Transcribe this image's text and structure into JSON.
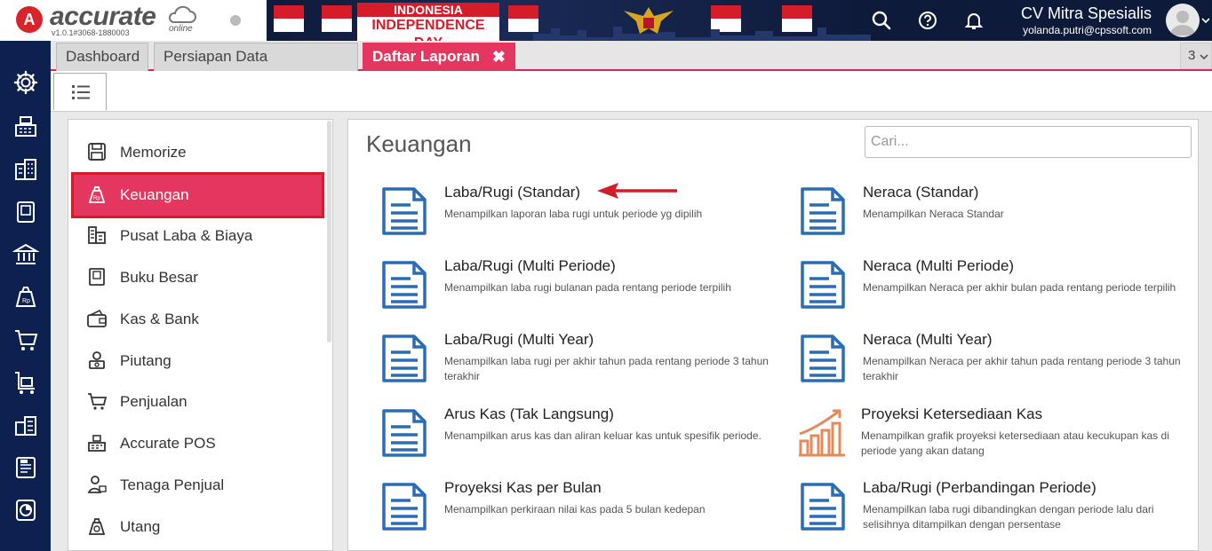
{
  "app": {
    "logo_letter": "A",
    "logo_text": "accurate",
    "logo_sub": "online",
    "version": "v1.0.1#3068-1880003"
  },
  "banner": {
    "line1": "INDONESIA",
    "line2": "INDEPENDENCE DAY"
  },
  "user": {
    "company": "CV Mitra Spesialis",
    "email": "yolanda.putri@cpssoft.com"
  },
  "tabs": [
    {
      "label": "Dashboard"
    },
    {
      "label": "Persiapan Data Perusahaan"
    },
    {
      "label": "Daftar Laporan"
    }
  ],
  "tab_close": "✖",
  "tab_count": "3",
  "sidebar": {
    "items": [
      {
        "label": "Memorize",
        "icon": "save-icon"
      },
      {
        "label": "Keuangan",
        "icon": "money-bag-icon"
      },
      {
        "label": "Pusat Laba & Biaya",
        "icon": "building-icon"
      },
      {
        "label": "Buku Besar",
        "icon": "ledger-icon"
      },
      {
        "label": "Kas & Bank",
        "icon": "wallet-icon"
      },
      {
        "label": "Piutang",
        "icon": "receivable-icon"
      },
      {
        "label": "Penjualan",
        "icon": "cart-icon"
      },
      {
        "label": "Accurate POS",
        "icon": "cash-register-icon"
      },
      {
        "label": "Tenaga Penjual",
        "icon": "salesperson-icon"
      },
      {
        "label": "Utang",
        "icon": "payable-icon"
      }
    ],
    "active_index": 1
  },
  "main": {
    "title": "Keuangan",
    "search_placeholder": "Cari...",
    "reports": [
      {
        "title": "Laba/Rugi (Standar)",
        "desc": "Menampilkan laporan laba rugi untuk periode yg dipilih",
        "icon": "document-icon"
      },
      {
        "title": "Neraca (Standar)",
        "desc": "Menampilkan Neraca Standar",
        "icon": "document-icon"
      },
      {
        "title": "Laba/Rugi (Multi Periode)",
        "desc": "Menampilkan laba rugi bulanan pada rentang periode terpilih",
        "icon": "document-icon"
      },
      {
        "title": "Neraca (Multi Periode)",
        "desc": "Menampilkan Neraca per akhir bulan pada rentang periode terpilih",
        "icon": "document-icon"
      },
      {
        "title": "Laba/Rugi (Multi Year)",
        "desc": "Menampilkan laba rugi per akhir tahun pada rentang periode 3 tahun terakhir",
        "icon": "document-icon"
      },
      {
        "title": "Neraca (Multi Year)",
        "desc": "Menampilkan Neraca per akhir tahun pada rentang periode 3 tahun terakhir",
        "icon": "document-icon"
      },
      {
        "title": "Arus Kas (Tak Langsung)",
        "desc": "Menampilkan arus kas dan aliran keluar kas untuk spesifik periode.",
        "icon": "document-icon"
      },
      {
        "title": "Proyeksi Ketersediaan Kas",
        "desc": "Menampilkan grafik proyeksi ketersediaan atau kecukupan kas di periode yang akan datang",
        "icon": "growth-chart-icon"
      },
      {
        "title": "Proyeksi Kas per Bulan",
        "desc": "Menampilkan perkiraan nilai kas pada 5 bulan kedepan",
        "icon": "document-icon"
      },
      {
        "title": "Laba/Rugi (Perbandingan Periode)",
        "desc": "Menampilkan laba rugi dibandingkan dengan periode lalu dari selisihnya ditampilkan dengan persentase",
        "icon": "document-icon"
      }
    ]
  },
  "colors": {
    "accent": "#e5365f",
    "nav_bg": "#0d2150",
    "doc_icon": "#2a6db5",
    "chart_icon": "#e58a5a",
    "highlight": "#d51c2b"
  }
}
